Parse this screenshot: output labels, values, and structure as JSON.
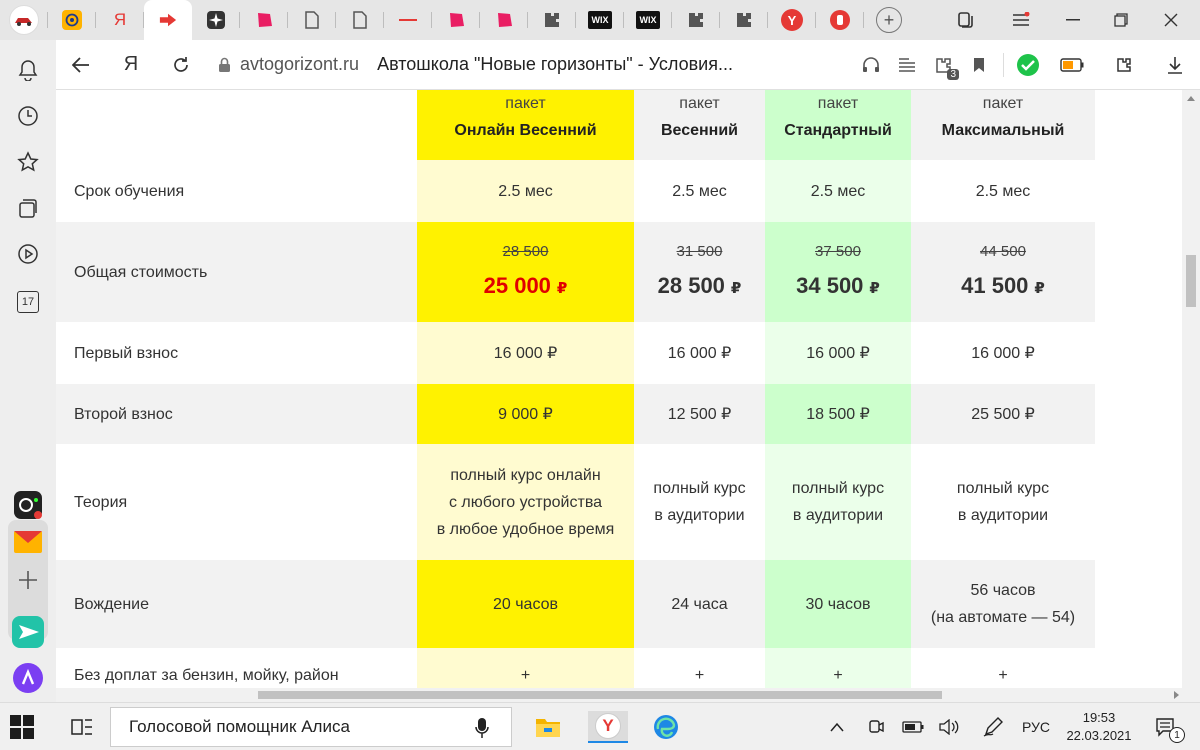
{
  "browser": {
    "tabs": [
      {
        "icon": "red-car-favicon",
        "color": "#c62828",
        "active": false
      },
      {
        "icon": "at-favicon",
        "color": "#1e88e5",
        "active": false
      },
      {
        "icon": "yandex-ya-favicon",
        "color": "#e53935",
        "active": false
      },
      {
        "icon": "red-arrow-favicon",
        "color": "#e53935",
        "active": true
      },
      {
        "icon": "star-favicon",
        "color": "#333333",
        "active": false
      },
      {
        "icon": "pink-shape-favicon",
        "color": "#e91e63",
        "active": false
      },
      {
        "icon": "document-favicon",
        "color": "#555555",
        "active": false
      },
      {
        "icon": "document-favicon",
        "color": "#555555",
        "active": false
      },
      {
        "icon": "red-text-favicon",
        "color": "#e53935",
        "active": false
      },
      {
        "icon": "pink-shape-favicon",
        "color": "#e91e63",
        "active": false
      },
      {
        "icon": "pink-shape-favicon",
        "color": "#e91e63",
        "active": false
      },
      {
        "icon": "puzzle-favicon",
        "color": "#555555",
        "active": false
      },
      {
        "icon": "wix-favicon",
        "color": "#111111",
        "active": false
      },
      {
        "icon": "wix-favicon",
        "color": "#111111",
        "active": false
      },
      {
        "icon": "puzzle-favicon",
        "color": "#555555",
        "active": false
      },
      {
        "icon": "puzzle-favicon",
        "color": "#555555",
        "active": false
      },
      {
        "icon": "yandex-y-favicon",
        "color": "#e53935",
        "active": false
      },
      {
        "icon": "red-glyph-favicon",
        "color": "#e53935",
        "active": false
      }
    ],
    "tab_text": {
      "ya": "Я",
      "wix": "WIX",
      "y": "Y"
    },
    "address": {
      "domain": "avtogorizont.ru",
      "title": "Автошкола \"Новые горизонты\" - Условия...",
      "yandex_logo": "Я",
      "badge_count": "3"
    }
  },
  "sidebar": {
    "calendar_day": "17"
  },
  "pricing": {
    "packages": [
      {
        "top": "пакет",
        "name": "Онлайн Весенний",
        "header_bg": "#fff200",
        "cell_bg": "#fffbd0",
        "cell_bg_alt": "#fff200"
      },
      {
        "top": "пакет",
        "name": "Весенний",
        "header_bg": "#f2f2f2",
        "cell_bg": "#ffffff",
        "cell_bg_alt": "#f2f2f2"
      },
      {
        "top": "пакет",
        "name": "Стандартный",
        "header_bg": "#ccffcc",
        "cell_bg": "#ebffea",
        "cell_bg_alt": "#ccffcc"
      },
      {
        "top": "пакет",
        "name": "Максимальный",
        "header_bg": "#f2f2f2",
        "cell_bg": "#ffffff",
        "cell_bg_alt": "#f2f2f2"
      }
    ],
    "rows": [
      {
        "label": "Срок обучения",
        "values": [
          "2.5 мес",
          "2.5 мес",
          "2.5 мес",
          "2.5 мес"
        ]
      },
      {
        "label": "Общая стоимость",
        "old": [
          "28 500",
          "31 500",
          "37 500",
          "44 500"
        ],
        "new": [
          "25 000",
          "28 500",
          "34 500",
          "41 500"
        ],
        "currency": "₽"
      },
      {
        "label": "Первый взнос",
        "values": [
          "16 000 ₽",
          "16 000 ₽",
          "16 000 ₽",
          "16 000 ₽"
        ]
      },
      {
        "label": "Второй взнос",
        "values": [
          "9 000 ₽",
          "12 500 ₽",
          "18 500 ₽",
          "25 500 ₽"
        ]
      },
      {
        "label": "Теория",
        "values": [
          [
            "полный курс онлайн",
            "с любого устройства",
            "в любое удобное время"
          ],
          [
            "полный курс",
            "в аудитории"
          ],
          [
            "полный курс",
            "в аудитории"
          ],
          [
            "полный курс",
            "в аудитории"
          ]
        ]
      },
      {
        "label": "Вождение",
        "values": [
          [
            "20 часов"
          ],
          [
            "24 часа"
          ],
          [
            "30 часов"
          ],
          [
            "56 часов",
            "(на автомате — 54)"
          ]
        ]
      },
      {
        "label": "Без доплат за бензин, мойку, район",
        "values": [
          "+",
          "+",
          "+",
          "+"
        ]
      }
    ],
    "label_bg_alt": "#f2f2f2"
  },
  "taskbar": {
    "search_text": "Голосовой помощник Алиса",
    "yandex_letter": "Y",
    "language": "РУС",
    "time": "19:53",
    "date": "22.03.2021",
    "notification_count": "1"
  }
}
